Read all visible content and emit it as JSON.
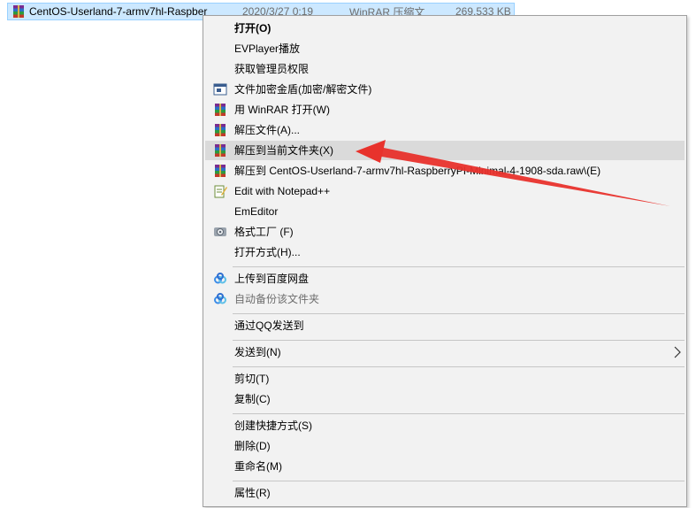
{
  "file": {
    "name": "CentOS-Userland-7-armv7hl-Raspber",
    "date": "2020/3/27 0:19",
    "type": "WinRAR 压缩文",
    "size": "269,533 KB",
    "icon": "winrar-archive-icon"
  },
  "menu": {
    "open": "打开(O)",
    "evplayer": "EVPlayer播放",
    "admin": "获取管理员权限",
    "encrypt": "文件加密金盾(加密/解密文件)",
    "open_winrar": "用 WinRAR 打开(W)",
    "extract_files": "解压文件(A)...",
    "extract_here": "解压到当前文件夹(X)",
    "extract_to": "解压到 CentOS-Userland-7-armv7hl-RaspberryPI-Minimal-4-1908-sda.raw\\(E)",
    "notepad": "Edit with Notepad++",
    "emeditor": "EmEditor",
    "format_factory": "格式工厂 (F)",
    "open_with": "打开方式(H)...",
    "baidu_upload": "上传到百度网盘",
    "baidu_backup": "自动备份该文件夹",
    "qq_send": "通过QQ发送到",
    "send_to": "发送到(N)",
    "cut": "剪切(T)",
    "copy": "复制(C)",
    "shortcut": "创建快捷方式(S)",
    "delete": "删除(D)",
    "rename": "重命名(M)",
    "properties": "属性(R)"
  },
  "colors": {
    "menu_bg": "#f2f2f2",
    "highlight": "#dadada",
    "selection": "#cce8ff",
    "annotation": "#e8322c"
  }
}
